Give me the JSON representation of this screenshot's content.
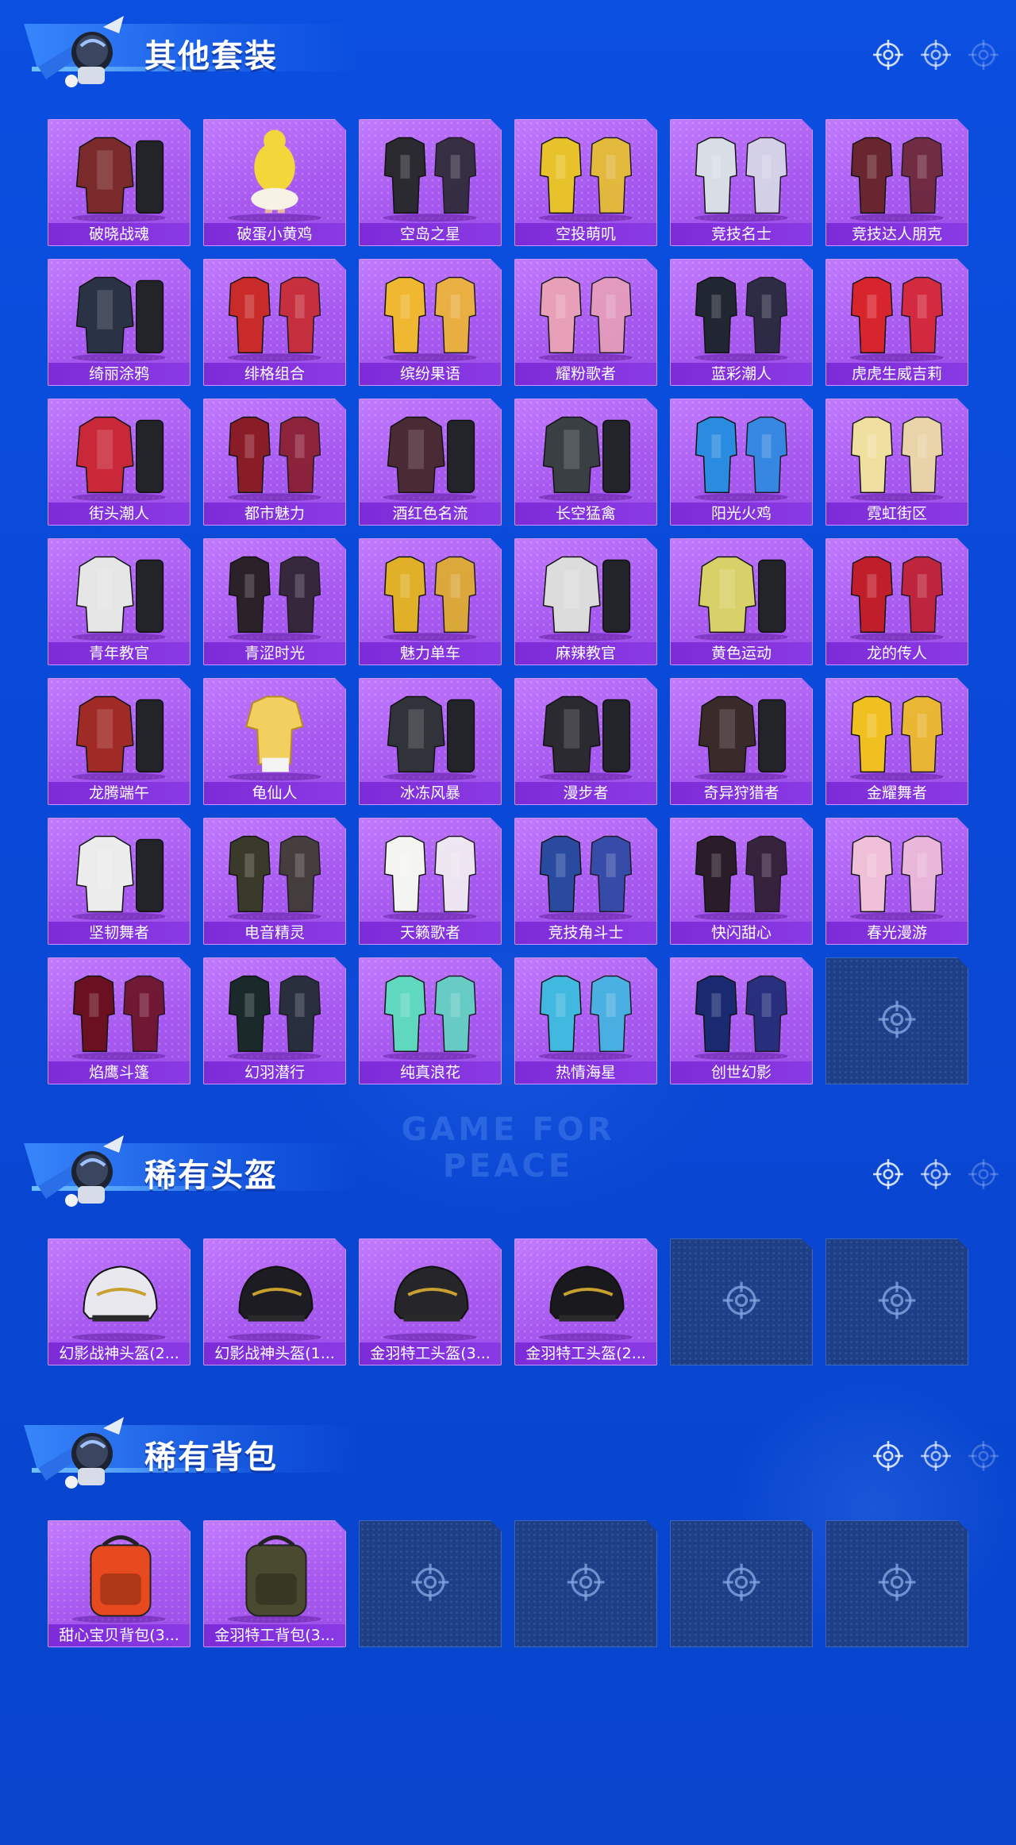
{
  "watermark": "GAME FOR PEACE",
  "sections": [
    {
      "title": "其他套装",
      "items": [
        {
          "label": "破晓战魂",
          "kind": "outfit",
          "tone": "#7a2a2a"
        },
        {
          "label": "破蛋小黄鸡",
          "kind": "chick",
          "tone": "#f2d63a"
        },
        {
          "label": "空岛之星",
          "kind": "pair",
          "tone": "#2a2a30"
        },
        {
          "label": "空投萌叽",
          "kind": "pair",
          "tone": "#e8c22a"
        },
        {
          "label": "竞技名士",
          "kind": "pair",
          "tone": "#d8dde6"
        },
        {
          "label": "竞技达人朋克",
          "kind": "pair",
          "tone": "#6a2630"
        },
        {
          "label": "绮丽涂鸦",
          "kind": "outfit",
          "tone": "#2a3346"
        },
        {
          "label": "绯格组合",
          "kind": "pair",
          "tone": "#c92a2a"
        },
        {
          "label": "缤纷果语",
          "kind": "pair",
          "tone": "#f0b830"
        },
        {
          "label": "耀粉歌者",
          "kind": "pair",
          "tone": "#e8a0b8"
        },
        {
          "label": "蓝彩潮人",
          "kind": "pair",
          "tone": "#202632"
        },
        {
          "label": "虎虎生威吉莉",
          "kind": "pair",
          "tone": "#d8242c"
        },
        {
          "label": "街头潮人",
          "kind": "outfit",
          "tone": "#c82838"
        },
        {
          "label": "都市魅力",
          "kind": "pair",
          "tone": "#8a1c28"
        },
        {
          "label": "酒红色名流",
          "kind": "outfit",
          "tone": "#4a2a34"
        },
        {
          "label": "长空猛禽",
          "kind": "outfit",
          "tone": "#3a3f44"
        },
        {
          "label": "阳光火鸡",
          "kind": "pair",
          "tone": "#2a8ce0"
        },
        {
          "label": "霓虹街区",
          "kind": "pair",
          "tone": "#f0e0a0"
        },
        {
          "label": "青年教官",
          "kind": "outfit",
          "tone": "#e6e6e6"
        },
        {
          "label": "青涩时光",
          "kind": "pair",
          "tone": "#2a2228"
        },
        {
          "label": "魅力单车",
          "kind": "pair",
          "tone": "#e0b028"
        },
        {
          "label": "麻辣教官",
          "kind": "outfit",
          "tone": "#dcdcdc"
        },
        {
          "label": "黄色运动",
          "kind": "outfit",
          "tone": "#d8d068"
        },
        {
          "label": "龙的传人",
          "kind": "pair",
          "tone": "#c01e2a"
        },
        {
          "label": "龙腾端午",
          "kind": "outfit",
          "tone": "#a02a26"
        },
        {
          "label": "龟仙人",
          "kind": "shirt",
          "tone": "#f2d060"
        },
        {
          "label": "冰冻风暴",
          "kind": "outfit",
          "tone": "#30343a"
        },
        {
          "label": "漫步者",
          "kind": "outfit",
          "tone": "#2a2a30"
        },
        {
          "label": "奇异狩猎者",
          "kind": "outfit",
          "tone": "#3a2a2a"
        },
        {
          "label": "金耀舞者",
          "kind": "pair",
          "tone": "#f0c020"
        },
        {
          "label": "坚韧舞者",
          "kind": "outfit",
          "tone": "#ececec"
        },
        {
          "label": "电音精灵",
          "kind": "pair",
          "tone": "#3a3a2a"
        },
        {
          "label": "天籁歌者",
          "kind": "pair",
          "tone": "#f4f4f0"
        },
        {
          "label": "竞技角斗士",
          "kind": "pair",
          "tone": "#2a4aa0"
        },
        {
          "label": "快闪甜心",
          "kind": "pair",
          "tone": "#2a1c28"
        },
        {
          "label": "春光漫游",
          "kind": "pair",
          "tone": "#f0c0d8"
        },
        {
          "label": "焰鹰斗篷",
          "kind": "pair",
          "tone": "#6a1020"
        },
        {
          "label": "幻羽潜行",
          "kind": "pair",
          "tone": "#1a2a2a"
        },
        {
          "label": "纯真浪花",
          "kind": "pair",
          "tone": "#60d8c0"
        },
        {
          "label": "热情海星",
          "kind": "pair",
          "tone": "#40b8e0"
        },
        {
          "label": "创世幻影",
          "kind": "pair",
          "tone": "#1a2a70"
        }
      ],
      "empty_slots": 1
    },
    {
      "title": "稀有头盔",
      "items": [
        {
          "label": "幻影战神头盔(2...",
          "kind": "helmet",
          "tone": "#e8e8ee"
        },
        {
          "label": "幻影战神头盔(1...",
          "kind": "helmet",
          "tone": "#1c1c22"
        },
        {
          "label": "金羽特工头盔(3...",
          "kind": "helmet",
          "tone": "#26262a"
        },
        {
          "label": "金羽特工头盔(2...",
          "kind": "helmet",
          "tone": "#1a1a1e"
        }
      ],
      "empty_slots": 2
    },
    {
      "title": "稀有背包",
      "items": [
        {
          "label": "甜心宝贝背包(3...",
          "kind": "backpack",
          "tone": "#e84a20"
        },
        {
          "label": "金羽特工背包(3...",
          "kind": "backpack",
          "tone": "#4a4a30"
        }
      ],
      "empty_slots": 4
    }
  ]
}
